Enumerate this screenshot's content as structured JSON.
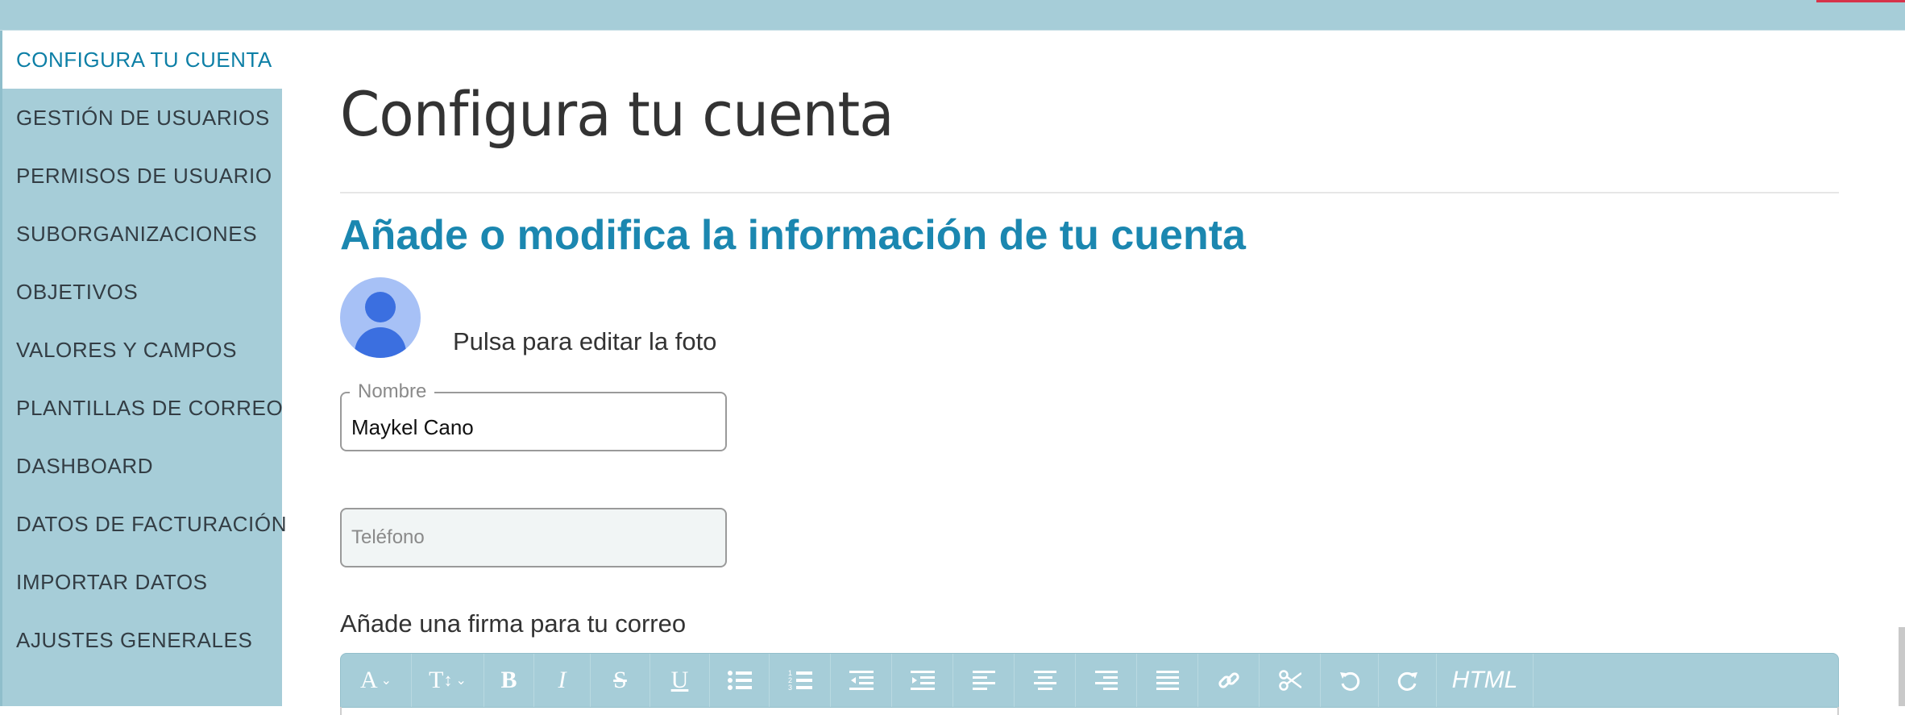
{
  "sidebar": {
    "active": "CONFIGURA TU CUENTA",
    "items": [
      "GESTIÓN DE USUARIOS",
      "PERMISOS DE USUARIO",
      "SUBORGANIZACIONES",
      "OBJETIVOS",
      "VALORES Y CAMPOS",
      "PLANTILLAS DE CORREO",
      "DASHBOARD",
      "DATOS DE FACTURACIÓN",
      "IMPORTAR DATOS",
      "AJUSTES GENERALES"
    ]
  },
  "main": {
    "title": "Configura tu cuenta",
    "subtitle": "Añade o modifica la información de tu cuenta",
    "photo_caption": "Pulsa para editar la foto",
    "name_field": {
      "label": "Nombre",
      "value": "Maykel Cano"
    },
    "phone_field": {
      "placeholder": "Teléfono",
      "value": ""
    },
    "signature_label": "Añade una firma para tu correo"
  },
  "toolbar": {
    "html_label": "HTML",
    "font_label": "A",
    "size_label": "T",
    "bold_label": "B",
    "italic_label": "I",
    "strike_label": "S",
    "underline_label": "U",
    "buttons": [
      "font-color",
      "font-size",
      "bold",
      "italic",
      "strikethrough",
      "underline",
      "bullet-list",
      "numbered-list",
      "outdent",
      "indent",
      "align-left",
      "align-center",
      "align-right",
      "justify",
      "link",
      "cut",
      "undo",
      "redo",
      "html"
    ]
  },
  "colors": {
    "accent": "#1b87b0",
    "sidebar_bg": "#a6cdd8",
    "avatar_bg": "#a7c1f6",
    "avatar_fg": "#3b6fe0"
  }
}
